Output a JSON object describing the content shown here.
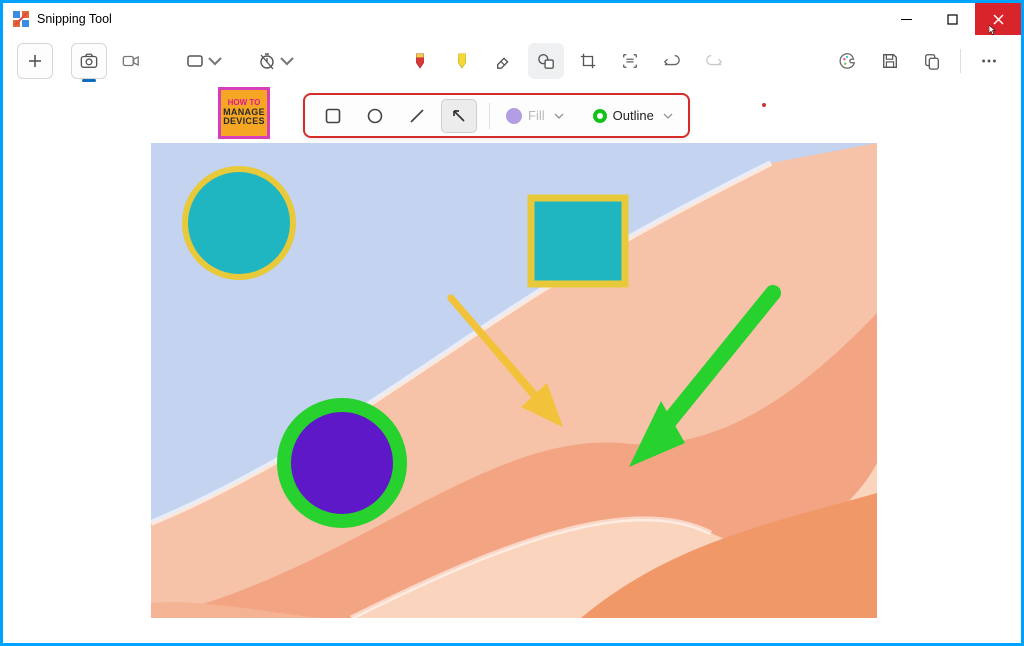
{
  "window": {
    "title": "Snipping Tool"
  },
  "toolbar": {
    "new": "New",
    "snip_mode": "Snapshot",
    "video_mode": "Record",
    "shape_dropdown": "Rectangle mode",
    "delay_dropdown": "No delay",
    "highlighter_red": "Red marker",
    "highlighter_yellow": "Yellow highlighter",
    "eraser": "Eraser",
    "shapes": "Shapes",
    "crop": "Crop",
    "text_extract": "Text actions",
    "undo": "Undo",
    "redo": "Redo",
    "paint_edit": "Edit in Paint",
    "save": "Save",
    "copy": "Copy",
    "more": "More"
  },
  "shape_toolbar": {
    "rectangle": "Rectangle",
    "circle": "Circle",
    "line": "Line",
    "arrow": "Arrow",
    "fill_label": "Fill",
    "outline_label": "Outline",
    "fill_color": "#b39ee6",
    "outline_color": "#14c21a"
  },
  "badge": {
    "line1": "HOW TO",
    "line2": "MANAGE",
    "line3": "DEVICES"
  },
  "canvas": {
    "bg_top": "#c3d3f0",
    "wave1": "#f7b89a",
    "wave2": "#f19d72",
    "wave3": "#ee8a55",
    "shapes": {
      "circle_teal": {
        "fill": "#1fb6c1",
        "stroke": "#e8c93a"
      },
      "square_teal": {
        "fill": "#1fb6c1",
        "stroke": "#e8c93a"
      },
      "circle_purple": {
        "fill": "#5f18c8",
        "stroke": "#27d12e"
      },
      "arrow_yellow": "#f2c33a",
      "arrow_green": "#27d12e"
    }
  }
}
